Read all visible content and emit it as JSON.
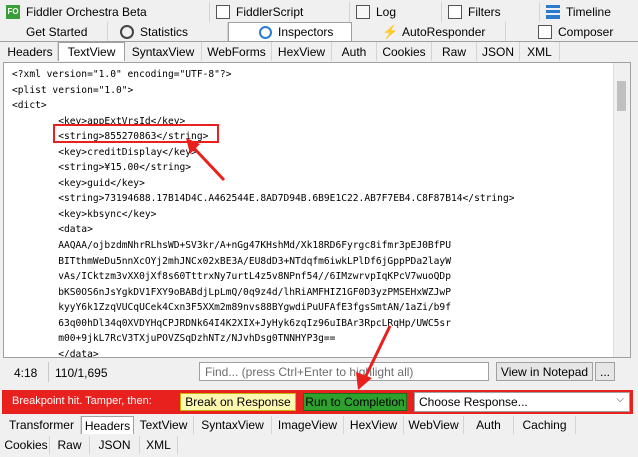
{
  "top_tabs_row1": [
    {
      "label": "Fiddler Orchestra Beta",
      "icon": "fo-icon"
    },
    {
      "label": "FiddlerScript",
      "icon": "script-icon"
    },
    {
      "label": "Log",
      "icon": "log-icon"
    },
    {
      "label": "Filters",
      "icon": "checkbox-icon"
    },
    {
      "label": "Timeline",
      "icon": "timeline-icon"
    }
  ],
  "top_tabs_row2": [
    {
      "label": "Get Started"
    },
    {
      "label": "Statistics",
      "icon": "stopwatch-icon"
    },
    {
      "label": "Inspectors",
      "icon": "inspect-icon"
    },
    {
      "label": "AutoResponder",
      "icon": "lightning-icon"
    },
    {
      "label": "Composer",
      "icon": "composer-icon"
    }
  ],
  "request_tabs": [
    "Headers",
    "TextView",
    "SyntaxView",
    "WebForms",
    "HexView",
    "Auth",
    "Cookies",
    "Raw",
    "JSON",
    "XML"
  ],
  "request_active": "TextView",
  "code_text": "<?xml version=\"1.0\" encoding=\"UTF-8\"?>\n<plist version=\"1.0\">\n<dict>\n        <key>appExtVrsId</key>\n        <string>855270863</string>\n        <key>creditDisplay</key>\n        <string>¥15.00</string>\n        <key>guid</key>\n        <string>73194688.17B14D4C.A462544E.8AD7D94B.6B9E1C22.AB7F7EB4.C8F87B14</string>\n        <key>kbsync</key>\n        <data>\n        AAQAA/ojbzdmNhrRLhsWD+SV3kr/A+nGg47KHshMd/Xk18RD6Fyrgc8ifmr3pEJ0BfPU\n        BITthmWeDu5nnXcOYj2mhJNCx02xBE3A/EU8dD3+NTdqfm6iwkLPlDf6jGppPDa2layW\n        vAs/ICktzm3vXX0jXf8s60TttrxNy7urtL4z5v8NPnf54//6IMzwrvpIqKPcV7wuoQDp\n        bKS0OS6nJsYgkDV1FXY9oBABdjLpLmQ/0q9z4d/lhRiAMFHIZ1GF0D3yzPMSEHxWZJwP\n        kyyY6k1ZzqVUCqUCek4Cxn3F5XXm2m89nvs88BYgwdiPuUFAfE3fgsSmtAN/1aZi/b9f\n        63q00hDl34q0XVDYHqCPJRDNk64I4K2XIX+JyHyk6zqIz96uIBAr3RpcLRqHp/UWC5sr\n        m00+9jkL7RcV3TXjuPOVZSqDzhNTz/NJvhDsg0TNNHYP3g==\n        </data>\n        <key>machineName</key>",
  "status": {
    "position": "4:18",
    "counts": "110/1,695",
    "find_placeholder": "Find... (press Ctrl+Enter to highlight all)",
    "view_notepad": "View in Notepad",
    "more": "..."
  },
  "breakpoint_bar": {
    "message": "Breakpoint hit. Tamper, then:",
    "break_on_response": "Break on Response",
    "run_to_completion": "Run to Completion",
    "choose_response": "Choose Response..."
  },
  "response_tabs_row1": [
    "Transformer",
    "Headers",
    "TextView",
    "SyntaxView",
    "ImageView",
    "HexView",
    "WebView",
    "Auth",
    "Caching"
  ],
  "response_tabs_row2": [
    "Cookies",
    "Raw",
    "JSON",
    "XML"
  ],
  "response_active": "Headers",
  "colors": {
    "accent_red": "#e8201e",
    "run_green": "#2ea02e",
    "break_yellow": "#fff8b0"
  }
}
